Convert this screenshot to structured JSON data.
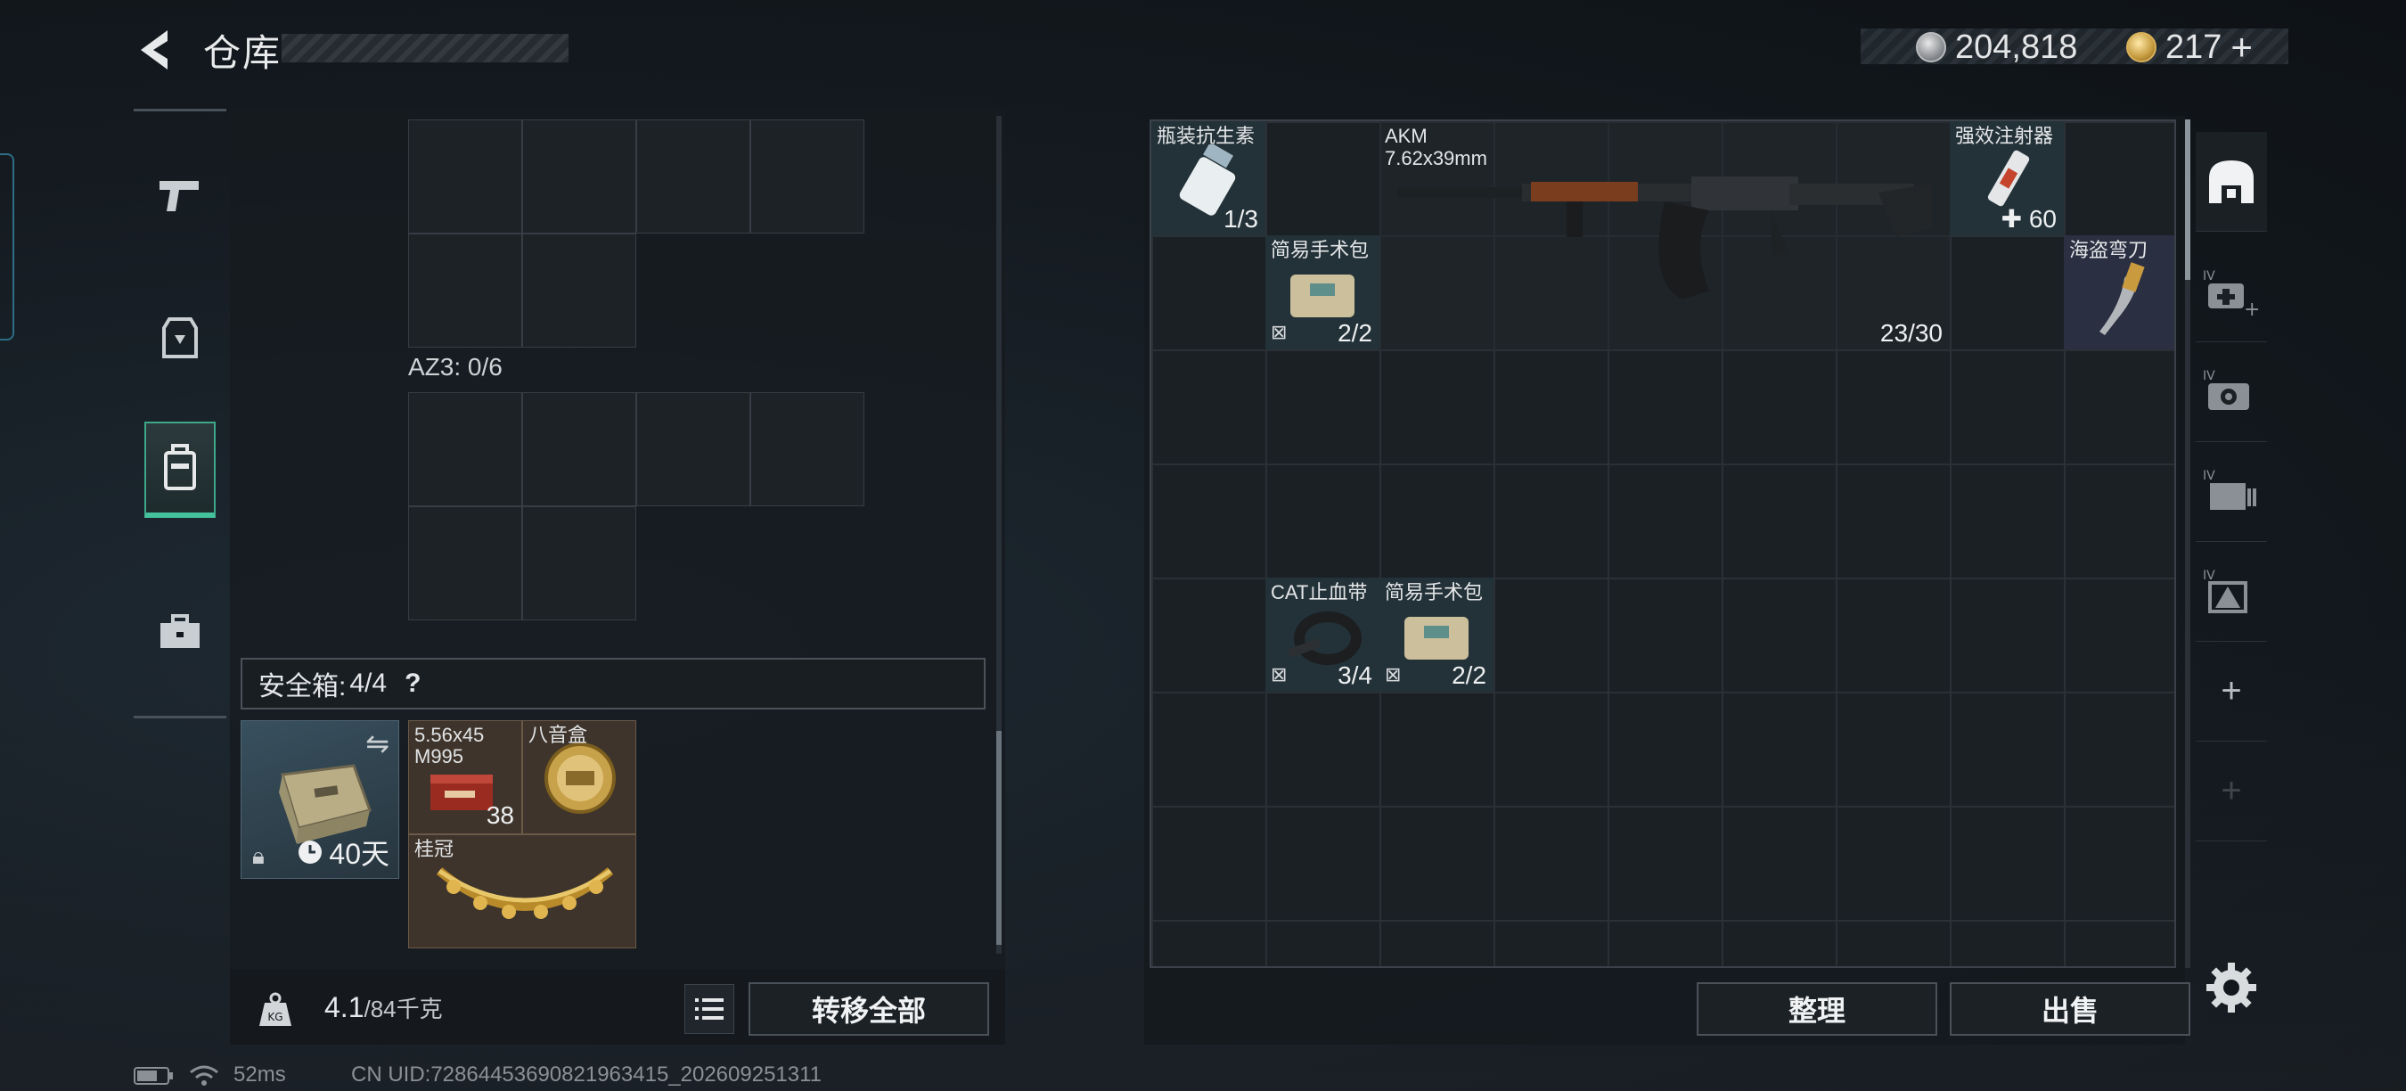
{
  "header": {
    "title": "仓库",
    "currency_silver": "204,818",
    "currency_gold": "217",
    "gold_add": "+"
  },
  "left": {
    "az_label": "AZ3: 0/6",
    "safe_box": {
      "label": "安全箱:",
      "count": "4/4",
      "help": "?"
    },
    "case_timer": "40天",
    "items": [
      {
        "name": "5.56x45\nM995",
        "count": "38"
      },
      {
        "name": "八音盒",
        "count": ""
      },
      {
        "name": "桂冠",
        "count": ""
      }
    ],
    "weight_value": "4.1",
    "weight_unit": "/84千克",
    "transfer_all": "转移全部"
  },
  "grid_items": [
    {
      "name": "瓶装抗生素",
      "count": "1/3"
    },
    {
      "name": "AKM",
      "sub": "7.62x39mm",
      "count": "23/30"
    },
    {
      "name": "强效注射器",
      "count": "60",
      "prefix": "✚"
    },
    {
      "name": "简易手术包",
      "count": "2/2"
    },
    {
      "name": "海盗弯刀",
      "count": ""
    },
    {
      "name": "CAT止血带",
      "count": "3/4"
    },
    {
      "name": "简易手术包",
      "count": "2/2"
    }
  ],
  "actions": {
    "sort": "整理",
    "sell": "出售"
  },
  "toolbar_icons": [
    "helmet-tab-icon",
    "med-add-icon",
    "camera-icon",
    "film-icon",
    "warning-icon",
    "add-icon",
    "add-disabled-icon"
  ],
  "status": {
    "ping": "52ms",
    "uid": "CN UID:72864453690821963415_202609251311"
  },
  "colors": {
    "accent": "#43c29d",
    "gold": "#c59a3e"
  }
}
